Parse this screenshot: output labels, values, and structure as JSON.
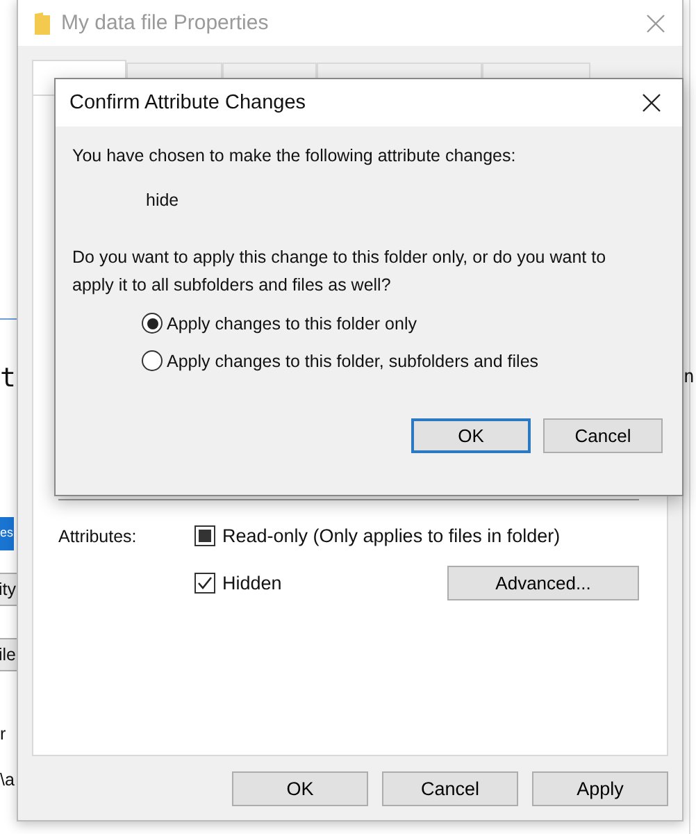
{
  "background_window": {
    "fragments": [
      {
        "text": "t",
        "kind": "large"
      },
      {
        "text": "n",
        "kind": "large-right"
      },
      {
        "text": "es",
        "kind": "selected"
      },
      {
        "text": "ity",
        "kind": "button"
      },
      {
        "text": "ile",
        "kind": "button"
      },
      {
        "text": "r",
        "kind": "plain"
      },
      {
        "text": "\\a",
        "kind": "plain"
      }
    ]
  },
  "properties_window": {
    "title": "My data file Properties",
    "active": false,
    "tabs": [
      {
        "selected": true
      },
      {
        "selected": false
      },
      {
        "selected": false
      },
      {
        "selected": false
      },
      {
        "selected": false
      }
    ],
    "attributes_label": "Attributes:",
    "attributes": [
      {
        "label": "Read-only (Only applies to files in folder)",
        "checked": false,
        "indeterminate": true
      },
      {
        "label": "Hidden",
        "checked": true,
        "indeterminate": false
      }
    ],
    "advanced_button": "Advanced...",
    "buttons": [
      "OK",
      "Cancel",
      "Apply"
    ]
  },
  "confirm_dialog": {
    "title": "Confirm Attribute Changes",
    "active": true,
    "intro": "You have chosen to make the following attribute changes:",
    "changes": [
      "hide"
    ],
    "question": "Do you want to apply this change to this folder only, or do you want to apply it to all subfolders and files as well?",
    "options": [
      {
        "label": "Apply changes to this folder only",
        "selected": true
      },
      {
        "label": "Apply changes to this folder, subfolders and files",
        "selected": false
      }
    ],
    "buttons": [
      {
        "label": "OK",
        "default": true
      },
      {
        "label": "Cancel",
        "default": false
      }
    ]
  }
}
